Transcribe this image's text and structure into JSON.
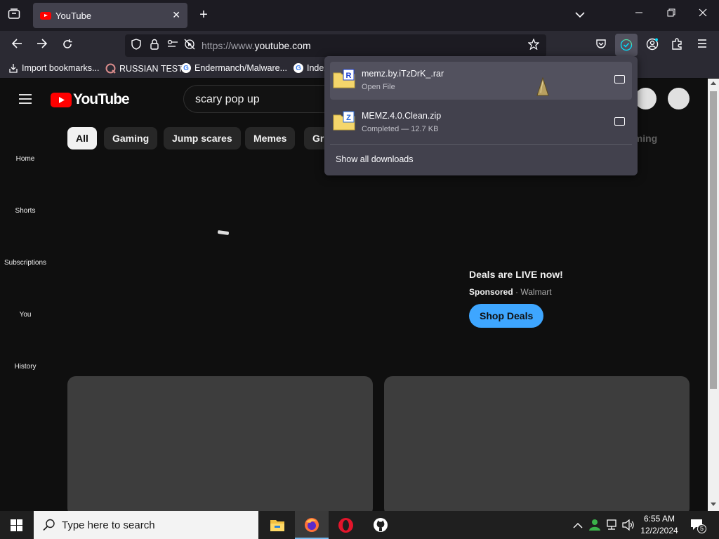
{
  "browser": {
    "tab": {
      "title": "YouTube"
    },
    "url": {
      "prefix": "https://www.",
      "domain": "youtube.com"
    },
    "bookmarks": [
      {
        "label": "Import bookmarks..."
      },
      {
        "label": "RUSSIAN TEST"
      },
      {
        "label": "Endermanch/Malware..."
      },
      {
        "label": "Index"
      }
    ]
  },
  "youtube": {
    "logo_text": "YouTube",
    "search": {
      "value": "scary pop up"
    },
    "chips": [
      {
        "label": "All"
      },
      {
        "label": "Gaming"
      },
      {
        "label": "Jump scares"
      },
      {
        "label": "Memes"
      },
      {
        "label": "Gri"
      },
      {
        "label": "aming"
      }
    ],
    "sidebar": [
      {
        "label": "Home"
      },
      {
        "label": "Shorts"
      },
      {
        "label": "Subscriptions"
      },
      {
        "label": "You"
      },
      {
        "label": "History"
      }
    ],
    "ad": {
      "title": "Deals are LIVE now!",
      "sponsored": "Sponsored",
      "separator": "·",
      "advertiser": "Walmart",
      "cta": "Shop Deals"
    }
  },
  "downloads": {
    "items": [
      {
        "name": "memz.by.iTzDrK_.rar",
        "status": "Open File",
        "badge": "R",
        "badge_color": "#1a3ccf"
      },
      {
        "name": "MEMZ.4.0.Clean.zip",
        "status": "Completed — 12.7 KB",
        "badge": "Z",
        "badge_color": "#2a6bd8"
      }
    ],
    "show_all": "Show all downloads"
  },
  "taskbar": {
    "search_placeholder": "Type here to search",
    "time": "6:55 AM",
    "date": "12/2/2024",
    "notification_count": "5"
  }
}
